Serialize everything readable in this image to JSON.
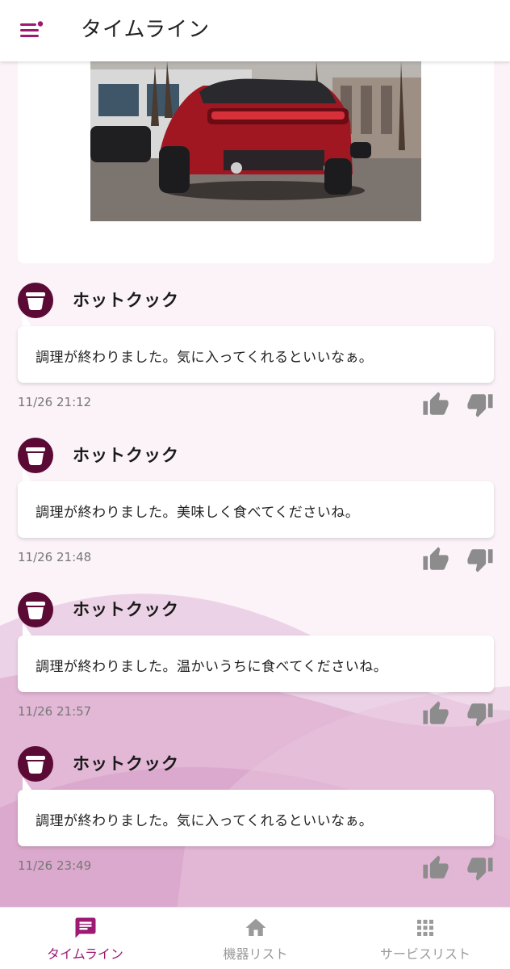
{
  "header": {
    "title": "タイムライン",
    "menu_icon": "menu-icon"
  },
  "colors": {
    "accent": "#9c1a72",
    "avatar": "#5a0a35",
    "icon_gray": "#8c8c8c",
    "wave_light": "#e7c4de",
    "wave_dark": "#d9a6cb"
  },
  "timeline": {
    "image_alt_icon": "car-photo",
    "messages": [
      {
        "sender": "ホットクック",
        "text": "調理が終わりました。気に入ってくれるといいなぁ。",
        "time": "11/26 21:12"
      },
      {
        "sender": "ホットクック",
        "text": "調理が終わりました。美味しく食べてくださいね。",
        "time": "11/26 21:48"
      },
      {
        "sender": "ホットクック",
        "text": "調理が終わりました。温かいうちに食べてくださいね。",
        "time": "11/26 21:57"
      },
      {
        "sender": "ホットクック",
        "text": "調理が終わりました。気に入ってくれるといいなぁ。",
        "time": "11/26 23:49"
      }
    ]
  },
  "bottom_nav": {
    "items": [
      {
        "label": "タイムライン",
        "icon": "chat-icon",
        "active": true
      },
      {
        "label": "機器リスト",
        "icon": "home-icon",
        "active": false
      },
      {
        "label": "サービスリスト",
        "icon": "apps-grid-icon",
        "active": false
      }
    ]
  }
}
